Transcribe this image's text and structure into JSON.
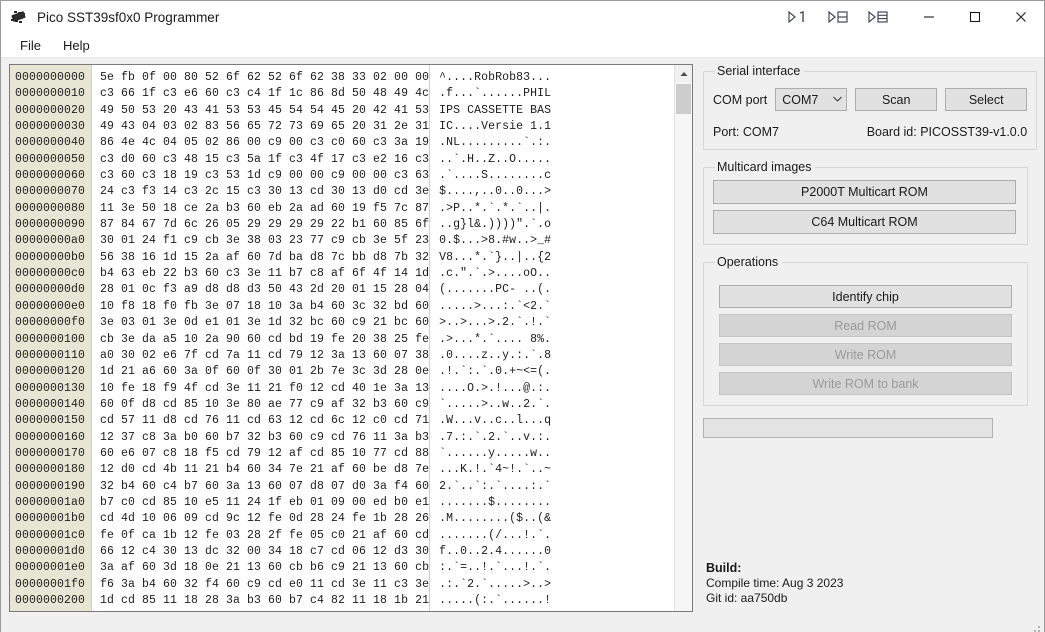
{
  "window": {
    "title": "Pico SST39sf0x0 Programmer",
    "app_icon": "chip-icon",
    "extra_icons": [
      "snap-layout-1-icon",
      "snap-layout-2-icon",
      "snap-layout-3-icon"
    ],
    "minimize_label": "—",
    "maximize_label": "☐",
    "close_label": "✕"
  },
  "menubar": {
    "items": [
      {
        "label": "File"
      },
      {
        "label": "Help"
      }
    ]
  },
  "hexviewer": {
    "scrollbar": {
      "up_arrow": "▲",
      "down_arrow": "▼",
      "thumb": "scroll-thumb"
    },
    "rows": [
      {
        "addr": "0000000000",
        "hex": "5e fb 0f 00 80 52 6f 62 52 6f 62 38 33 02 00 00",
        "ascii": "^....RobRob83..."
      },
      {
        "addr": "0000000010",
        "hex": "c3 66 1f c3 e6 60 c3 c4 1f 1c 86 8d 50 48 49 4c",
        "ascii": ".f...`......PHIL"
      },
      {
        "addr": "0000000020",
        "hex": "49 50 53 20 43 41 53 53 45 54 54 45 20 42 41 53",
        "ascii": "IPS CASSETTE BAS"
      },
      {
        "addr": "0000000030",
        "hex": "49 43 04 03 02 83 56 65 72 73 69 65 20 31 2e 31",
        "ascii": "IC....Versie 1.1"
      },
      {
        "addr": "0000000040",
        "hex": "86 4e 4c 04 05 02 86 00 c9 00 c3 c0 60 c3 3a 19",
        "ascii": ".NL.........`.:."
      },
      {
        "addr": "0000000050",
        "hex": "c3 d0 60 c3 48 15 c3 5a 1f c3 4f 17 c3 e2 16 c3",
        "ascii": "..`.H..Z..O....."
      },
      {
        "addr": "0000000060",
        "hex": "c3 60 c3 18 19 c3 53 1d c9 00 00 c9 00 00 c3 63",
        "ascii": ".`....S........c"
      },
      {
        "addr": "0000000070",
        "hex": "24 c3 f3 14 c3 2c 15 c3 30 13 cd 30 13 d0 cd 3e",
        "ascii": "$....,..0..0...>"
      },
      {
        "addr": "0000000080",
        "hex": "11 3e 50 18 ce 2a b3 60 eb 2a ad 60 19 f5 7c 87",
        "ascii": ".>P..*.`.*.`..|."
      },
      {
        "addr": "0000000090",
        "hex": "87 84 67 7d 6c 26 05 29 29 29 29 22 b1 60 85 6f",
        "ascii": "..g}l&.))))\".`.o"
      },
      {
        "addr": "00000000a0",
        "hex": "30 01 24 f1 c9 cb 3e 38 03 23 77 c9 cb 3e 5f 23",
        "ascii": "0.$...>8.#w..>_#"
      },
      {
        "addr": "00000000b0",
        "hex": "56 38 16 1d 15 2a af 60 7d ba d8 7c bb d8 7b 32",
        "ascii": "V8...*.`}..|..{2"
      },
      {
        "addr": "00000000c0",
        "hex": "b4 63 eb 22 b3 60 c3 3e 11 b7 c8 af 6f 4f 14 1d",
        "ascii": ".c.\".`.>....oO.."
      },
      {
        "addr": "00000000d0",
        "hex": "28 01 0c f3 a9 d8 d8 d3 50 43 2d 20 01 15 28 04",
        "ascii": "(.......PC- ..(."
      },
      {
        "addr": "00000000e0",
        "hex": "10 f8 18 f0 fb 3e 07 18 10 3a b4 60 3c 32 bd 60",
        "ascii": ".....>...:.`<2.`"
      },
      {
        "addr": "00000000f0",
        "hex": "3e 03 01 3e 0d e1 01 3e 1d 32 bc 60 c9 21 bc 60",
        "ascii": ">..>...>.2.`.!.`"
      },
      {
        "addr": "0000000100",
        "hex": "cb 3e da a5 10 2a 90 60 cd bd 19 fe 20 38 25 fe",
        "ascii": ".>...*.`.... 8%."
      },
      {
        "addr": "0000000110",
        "hex": "a0 30 02 e6 7f cd 7a 11 cd 79 12 3a 13 60 07 38",
        "ascii": ".0....z..y.:.`.8"
      },
      {
        "addr": "0000000120",
        "hex": "1d 21 a6 60 3a 0f 60 0f 30 01 2b 7e 3c 3d 28 0e",
        "ascii": ".!.`:.`.0.+~<=(."
      },
      {
        "addr": "0000000130",
        "hex": "10 fe 18 f9 4f cd 3e 11 21 f0 12 cd 40 1e 3a 13",
        "ascii": "....O.>.!...@.:."
      },
      {
        "addr": "0000000140",
        "hex": "60 0f d8 cd 85 10 3e 80 ae 77 c9 af 32 b3 60 c9",
        "ascii": "`.....>..w..2.`."
      },
      {
        "addr": "0000000150",
        "hex": "cd 57 11 d8 cd 76 11 cd 63 12 cd 6c 12 c0 cd 71",
        "ascii": ".W...v..c..l...q"
      },
      {
        "addr": "0000000160",
        "hex": "12 37 c8 3a b0 60 b7 32 b3 60 c9 cd 76 11 3a b3",
        "ascii": ".7.:.`.2.`..v.:."
      },
      {
        "addr": "0000000170",
        "hex": "60 e6 07 c8 18 f5 cd 79 12 af cd 85 10 77 cd 88",
        "ascii": "`......y.....w.."
      },
      {
        "addr": "0000000180",
        "hex": "12 d0 cd 4b 11 21 b4 60 34 7e 21 af 60 be d8 7e",
        "ascii": "...K.!.`4~!.`..~"
      },
      {
        "addr": "0000000190",
        "hex": "32 b4 60 c4 b7 60 3a 13 60 07 d8 07 d0 3a f4 60",
        "ascii": "2.`..`:.`....:.`"
      },
      {
        "addr": "00000001a0",
        "hex": "b7 c0 cd 85 10 e5 11 24 1f eb 01 09 00 ed b0 e1",
        "ascii": ".......$........"
      },
      {
        "addr": "00000001b0",
        "hex": "cd 4d 10 06 09 cd 9c 12 fe 0d 28 24 fe 1b 28 26",
        "ascii": ".M........($..(&"
      },
      {
        "addr": "00000001c0",
        "hex": "fe 0f ca 1b 12 fe 03 28 2f fe 05 c0 21 af 60 cd",
        "ascii": ".......(/...!.`."
      },
      {
        "addr": "00000001d0",
        "hex": "66 12 c4 30 13 dc 32 00 34 18 c7 cd 06 12 d3 30",
        "ascii": "f..0..2.4......0"
      },
      {
        "addr": "00000001e0",
        "hex": "3a af 60 3d 18 0e 21 13 60 cb b6 c9 21 13 60 cb",
        "ascii": ":.`=..!.`...!.`."
      },
      {
        "addr": "00000001f0",
        "hex": "f6 3a b4 60 32 f4 60 c9 cd e0 11 cd 3e 11 c3 3e",
        "ascii": ".:.`2.`.....>..>"
      },
      {
        "addr": "0000000200",
        "hex": "1d cd 85 11 18 28 3a b3 60 b7 c4 82 11 18 1b 21",
        "ascii": ".....(:.`......!"
      }
    ]
  },
  "serial_interface": {
    "legend": "Serial interface",
    "com_port_label": "COM port",
    "com_port_value": "COM7",
    "com_port_options": [
      "COM7"
    ],
    "scan_label": "Scan",
    "select_label": "Select",
    "port_status": "Port: COM7",
    "board_id": "Board id: PICOSST39-v1.0.0"
  },
  "multicard_images": {
    "legend": "Multicard images",
    "buttons": [
      {
        "label": "P2000T Multicart ROM",
        "enabled": true
      },
      {
        "label": "C64 Multicart ROM",
        "enabled": true
      }
    ]
  },
  "operations": {
    "legend": "Operations",
    "buttons": [
      {
        "label": "Identify chip",
        "enabled": true
      },
      {
        "label": "Read ROM",
        "enabled": false
      },
      {
        "label": "Write ROM",
        "enabled": false
      },
      {
        "label": "Write ROM to bank",
        "enabled": false
      }
    ]
  },
  "progress": {
    "value": 0,
    "text": ""
  },
  "build": {
    "heading": "Build:",
    "compile_time": "Compile time: Aug 3 2023",
    "git_id": "Git id: aa750db"
  },
  "statusbar": {
    "text": ""
  },
  "colors": {
    "window_bg": "#f0f0f0",
    "addr_column_bg": "#e7e5d3",
    "button_bg": "#e1e1e1",
    "button_disabled_bg": "#d4d4d4",
    "disabled_text": "#9a9a9a"
  }
}
